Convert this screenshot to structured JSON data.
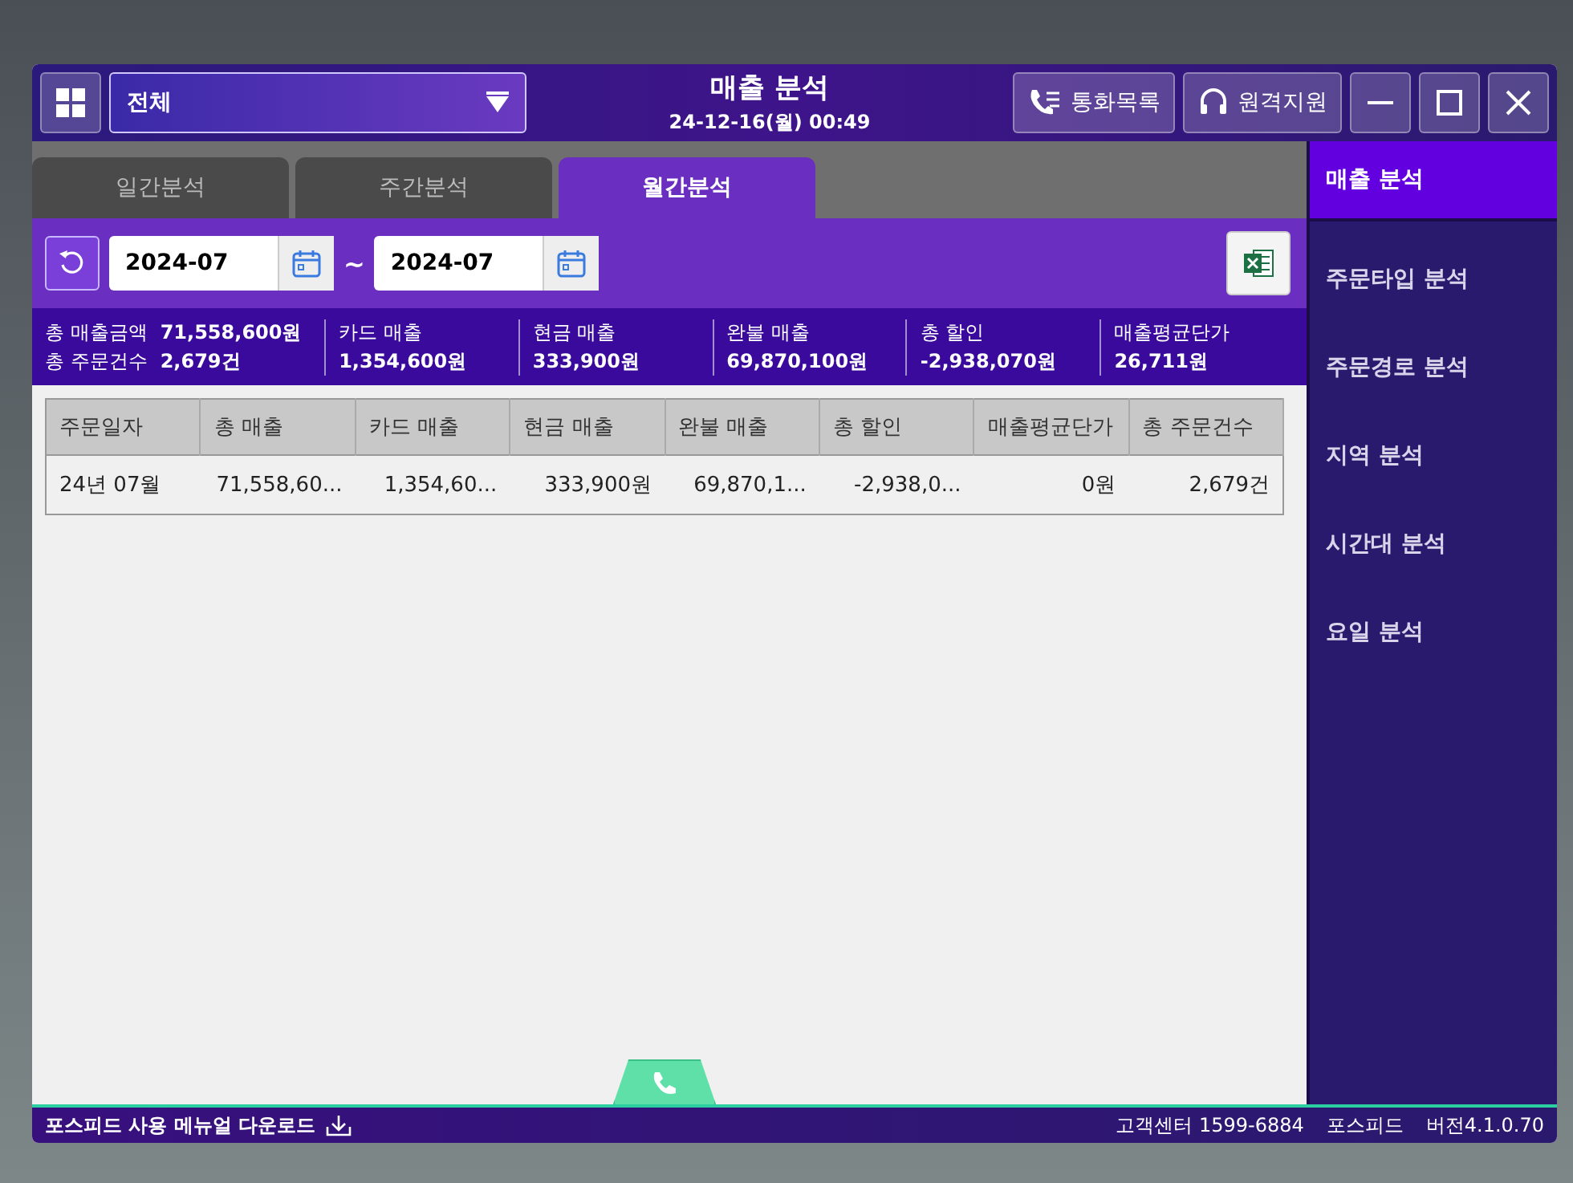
{
  "header": {
    "store_select": "전체",
    "title": "매출 분석",
    "datetime": "24-12-16(월) 00:49",
    "buttons": [
      {
        "kind": "phone",
        "label": "통화목록"
      },
      {
        "kind": "headset",
        "label": "원격지원"
      }
    ]
  },
  "tabs": [
    {
      "label": "일간분석",
      "selected": false
    },
    {
      "label": "주간분석",
      "selected": false
    },
    {
      "label": "월간분석",
      "selected": true
    }
  ],
  "date_range": {
    "from": "2024-07",
    "separator": "~",
    "to": "2024-07"
  },
  "summary": [
    {
      "rows": [
        {
          "label": "총 매출금액",
          "value": "71,558,600원"
        },
        {
          "label": "총 주문건수",
          "value": "2,679건"
        }
      ]
    },
    {
      "rows": [
        {
          "label": "카드 매출"
        },
        {
          "value": "1,354,600원"
        }
      ]
    },
    {
      "rows": [
        {
          "label": "현금 매출"
        },
        {
          "value": "333,900원"
        }
      ]
    },
    {
      "rows": [
        {
          "label": "완불 매출"
        },
        {
          "value": "69,870,100원"
        }
      ]
    },
    {
      "rows": [
        {
          "label": "총 할인"
        },
        {
          "value": "-2,938,070원"
        }
      ]
    },
    {
      "rows": [
        {
          "label": "매출평균단가"
        },
        {
          "value": "26,711원"
        }
      ]
    }
  ],
  "table": {
    "columns": [
      "주문일자",
      "총 매출",
      "카드 매출",
      "현금 매출",
      "완불 매출",
      "총 할인",
      "매출평균단가",
      "총 주문건수"
    ],
    "rows": [
      [
        "24년 07월",
        "71,558,60...",
        "1,354,60...",
        "333,900원",
        "69,870,1...",
        "-2,938,0...",
        "0원",
        "2,679건"
      ]
    ]
  },
  "sidebar": {
    "items": [
      {
        "label": "매출 분석",
        "selected": true
      },
      {
        "label": "주문타입 분석",
        "selected": false
      },
      {
        "label": "주문경로 분석",
        "selected": false
      },
      {
        "label": "지역 분석",
        "selected": false
      },
      {
        "label": "시간대 분석",
        "selected": false
      },
      {
        "label": "요일 분석",
        "selected": false
      }
    ]
  },
  "status_bar": {
    "manual_link": "포스피드 사용 메뉴얼 다운로드",
    "support": "고객센터 1599-6884",
    "brand": "포스피드",
    "version": "버전4.1.0.70"
  }
}
